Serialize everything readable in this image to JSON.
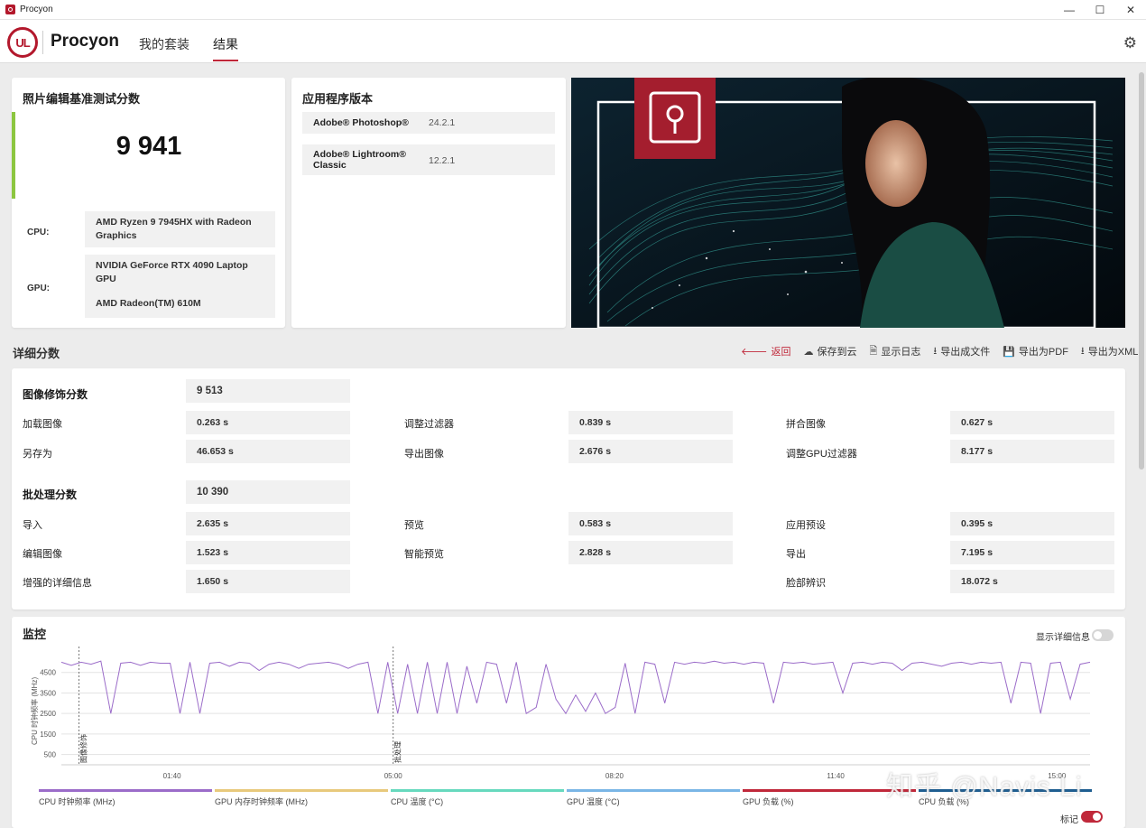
{
  "window": {
    "title": "Procyon",
    "controls": [
      "—",
      "☐",
      "✕"
    ]
  },
  "header": {
    "logo_text": "UL",
    "brand": "Procyon",
    "tabs": [
      {
        "label": "我的套装",
        "active": false
      },
      {
        "label": "结果",
        "active": true
      }
    ]
  },
  "score_card": {
    "title": "照片编辑基准测试分数",
    "score": "9 941",
    "cpu_label": "CPU:",
    "cpu_value": "AMD Ryzen 9 7945HX with Radeon Graphics",
    "gpu_label": "GPU:",
    "gpu_value_1": "NVIDIA GeForce RTX 4090 Laptop GPU",
    "gpu_value_2": "AMD Radeon(TM) 610M",
    "accent_color": "#8cc63f"
  },
  "version_card": {
    "title": "应用程序版本",
    "rows": [
      {
        "name": "Adobe® Photoshop®",
        "version": "24.2.1"
      },
      {
        "name": "Adobe® Lightroom® Classic",
        "version": "12.2.1"
      }
    ]
  },
  "details": {
    "title": "详细分数",
    "toolbar": [
      {
        "icon": "back-arrow-icon",
        "glyph": "🡐",
        "label": "返回"
      },
      {
        "icon": "cloud-icon",
        "glyph": "☁",
        "label": "保存到云"
      },
      {
        "icon": "document-icon",
        "glyph": "🗎",
        "label": "显示日志"
      },
      {
        "icon": "download-icon",
        "glyph": "⭳",
        "label": "导出成文件"
      },
      {
        "icon": "save-icon",
        "glyph": "💾",
        "label": "导出为PDF"
      },
      {
        "icon": "download-icon",
        "glyph": "⭳",
        "label": "导出为XML"
      }
    ],
    "retouch": {
      "label": "图像修饰分数",
      "score": "9 513",
      "items": [
        {
          "label": "加载图像",
          "value": "0.263 s"
        },
        {
          "label": "调整过滤器",
          "value": "0.839 s"
        },
        {
          "label": "拼合图像",
          "value": "0.627 s"
        },
        {
          "label": "另存为",
          "value": "46.653 s"
        },
        {
          "label": "导出图像",
          "value": "2.676 s"
        },
        {
          "label": "调整GPU过滤器",
          "value": "8.177 s"
        }
      ]
    },
    "batch": {
      "label": "批处理分数",
      "score": "10 390",
      "items": [
        {
          "label": "导入",
          "value": "2.635 s"
        },
        {
          "label": "预览",
          "value": "0.583 s"
        },
        {
          "label": "应用预设",
          "value": "0.395 s"
        },
        {
          "label": "编辑图像",
          "value": "1.523 s"
        },
        {
          "label": "智能预览",
          "value": "2.828 s"
        },
        {
          "label": "导出",
          "value": "7.195 s"
        },
        {
          "label": "增强的详细信息",
          "value": "1.650 s"
        },
        {
          "label": "脸部辨识",
          "value": "18.072 s"
        }
      ]
    }
  },
  "monitoring": {
    "title": "监控",
    "detail_toggle_label": "显示详细信息",
    "detail_toggle_on": false,
    "marker_toggle_label": "标记",
    "marker_toggle_on": true,
    "watermark": "知乎 @Navis Li"
  },
  "chart_data": {
    "type": "line",
    "ylabel": "CPU 时钟频率 (MHz)",
    "y_ticks": [
      "4500",
      "3500",
      "2500",
      "1500",
      "500"
    ],
    "x_ticks": [
      "01:40",
      "05:00",
      "08:20",
      "11:40",
      "15:00"
    ],
    "markers": [
      {
        "x": "00:16",
        "label": "图像修饰"
      },
      {
        "x": "05:00",
        "label": "批处理"
      }
    ],
    "series_color": "#9b6cc9",
    "series": [
      {
        "name": "CPU 时钟频率 (MHz)",
        "values": [
          5000,
          4850,
          5000,
          4900,
          5050,
          2500,
          4950,
          5000,
          4850,
          5000,
          4950,
          4950,
          2500,
          5000,
          2500,
          4950,
          5000,
          4800,
          5000,
          4950,
          4600,
          4900,
          5000,
          4900,
          4700,
          4900,
          4950,
          5000,
          4900,
          4700,
          4900,
          5000,
          2500,
          5000,
          2500,
          4900,
          2500,
          5000,
          2500,
          5000,
          2500,
          4800,
          3000,
          5000,
          4900,
          3000,
          5000,
          2500,
          2800,
          4900,
          3200,
          2500,
          3400,
          2600,
          3500,
          2500,
          2800,
          4950,
          2500,
          5000,
          4900,
          3000,
          5000,
          4900,
          5000,
          4950,
          5050,
          4950,
          5000,
          4900,
          5000,
          4950,
          3000,
          5000,
          4950,
          5000,
          4900,
          4950,
          5000,
          3500,
          4950,
          5000,
          4900,
          5000,
          4950,
          4600,
          4950,
          5000,
          4900,
          4800,
          4950,
          5000,
          4900,
          5000,
          4950,
          5000,
          3000,
          5000,
          4950,
          2500,
          4950,
          5000,
          3200,
          4900,
          5000
        ]
      }
    ],
    "legend": [
      {
        "label": "CPU 时钟频率 (MHz)",
        "color": "#9b6cc9"
      },
      {
        "label": "GPU 内存时钟频率 (MHz)",
        "color": "#e8c97c"
      },
      {
        "label": "CPU 温度 (°C)",
        "color": "#67d9be"
      },
      {
        "label": "GPU 温度 (°C)",
        "color": "#7ab6e6"
      },
      {
        "label": "GPU 负载 (%)",
        "color": "#c0283a"
      },
      {
        "label": "CPU 负载 (%)",
        "color": "#1f5e91"
      }
    ]
  }
}
